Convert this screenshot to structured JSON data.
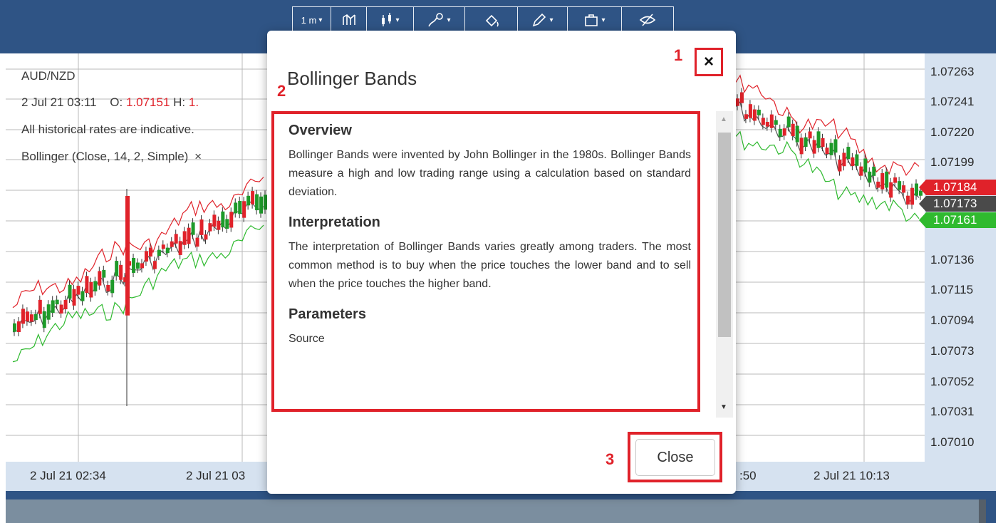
{
  "toolbar": {
    "buttons": [
      {
        "label": "1 m",
        "icon": "interval-icon",
        "caret": "▾"
      },
      {
        "label": "",
        "icon": "chart-type-icon",
        "caret": ""
      },
      {
        "label": "",
        "icon": "candlestick-icon",
        "caret": "▾"
      },
      {
        "label": "",
        "icon": "indicators-icon",
        "caret": "▾"
      },
      {
        "label": "",
        "icon": "paint-bucket-icon",
        "caret": ""
      },
      {
        "label": "",
        "icon": "draw-pen-icon",
        "caret": "▾"
      },
      {
        "label": "",
        "icon": "briefcase-icon",
        "caret": "▾"
      },
      {
        "label": "",
        "icon": "hide-eye-icon",
        "caret": ""
      }
    ]
  },
  "chart_info": {
    "symbol": "AUD/NZD",
    "datetime": "2 Jul 21 03:11",
    "open_label": "O:",
    "open_value": "1.07151",
    "high_label": "H:",
    "high_value": "1.",
    "disclaimer": "All historical rates are indicative.",
    "indicator": "Bollinger  (Close, 14, 2, Simple)",
    "indicator_remove": "×"
  },
  "price_axis": {
    "ticks": [
      "1.07263",
      "1.07241",
      "1.07220",
      "1.07199",
      "1.07136",
      "1.07115",
      "1.07094",
      "1.07073",
      "1.07052",
      "1.07031",
      "1.07010"
    ],
    "tags": [
      {
        "value": "1.07184",
        "color": "#e0222a"
      },
      {
        "value": "1.07173",
        "color": "#4a4a4a"
      },
      {
        "value": "1.07161",
        "color": "#2fba2f"
      }
    ]
  },
  "time_axis": {
    "labels": [
      "2 Jul 21 02:34",
      "2 Jul 21 03",
      ":50",
      "2 Jul 21 10:13"
    ]
  },
  "modal": {
    "title": "Bollinger Bands",
    "close_icon": "×",
    "sections": [
      {
        "heading": "Overview",
        "text": "Bollinger Bands were invented by John Bollinger in the 1980s. Bollinger Bands measure a high and low trading range using a calculation based on standard deviation."
      },
      {
        "heading": "Interpretation",
        "text": "The interpretation of Bollinger Bands varies greatly among traders. The most common method is to buy when the price touches the lower band and to sell when the price touches the higher band."
      },
      {
        "heading": "Parameters",
        "text": "Source"
      }
    ],
    "close_button": "Close"
  },
  "annotations": {
    "one": "1",
    "two": "2",
    "three": "3"
  },
  "colors": {
    "header": "#2f5485",
    "axis_bg": "#d6e2f0",
    "upper_band": "#e0222a",
    "lower_band": "#2fba2f",
    "middle_band": "#555555",
    "annotation": "#e0222a"
  }
}
